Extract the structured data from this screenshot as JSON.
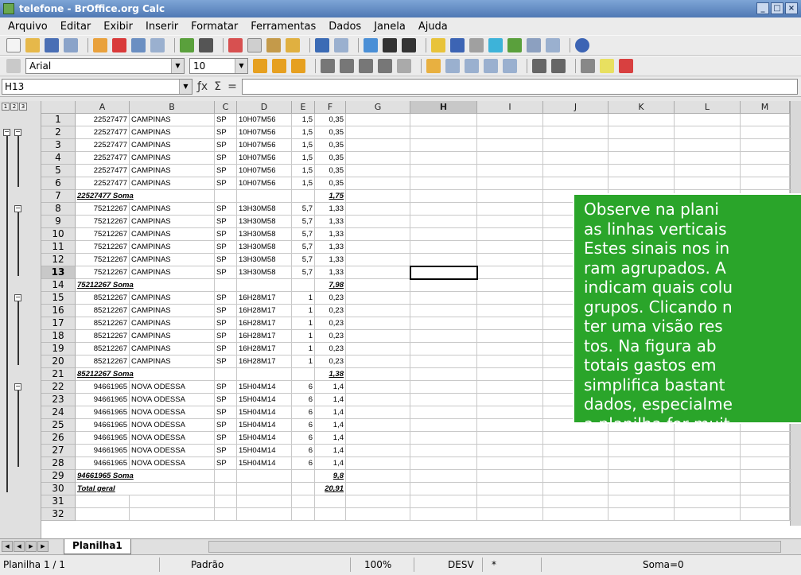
{
  "window": {
    "title": "telefone - BrOffice.org Calc",
    "buttons": [
      "_",
      "□",
      "×"
    ]
  },
  "menu": [
    "Arquivo",
    "Editar",
    "Exibir",
    "Inserir",
    "Formatar",
    "Ferramentas",
    "Dados",
    "Janela",
    "Ajuda"
  ],
  "formatting": {
    "font_name": "Arial",
    "font_size": "10"
  },
  "formula_bar": {
    "cell_ref": "H13",
    "content": ""
  },
  "outline_levels": [
    "1",
    "2",
    "3"
  ],
  "columns": [
    "A",
    "B",
    "C",
    "D",
    "E",
    "F",
    "G",
    "H",
    "I",
    "J",
    "K",
    "L",
    "M"
  ],
  "active_column": "H",
  "active_row": "13",
  "rows": [
    {
      "n": "1",
      "a": "22527477",
      "b": "CAMPINAS",
      "c": "SP",
      "d": "10H07M56",
      "e": "1,5",
      "f": "0,35"
    },
    {
      "n": "2",
      "a": "22527477",
      "b": "CAMPINAS",
      "c": "SP",
      "d": "10H07M56",
      "e": "1,5",
      "f": "0,35"
    },
    {
      "n": "3",
      "a": "22527477",
      "b": "CAMPINAS",
      "c": "SP",
      "d": "10H07M56",
      "e": "1,5",
      "f": "0,35"
    },
    {
      "n": "4",
      "a": "22527477",
      "b": "CAMPINAS",
      "c": "SP",
      "d": "10H07M56",
      "e": "1,5",
      "f": "0,35"
    },
    {
      "n": "5",
      "a": "22527477",
      "b": "CAMPINAS",
      "c": "SP",
      "d": "10H07M56",
      "e": "1,5",
      "f": "0,35"
    },
    {
      "n": "6",
      "a": "22527477",
      "b": "CAMPINAS",
      "c": "SP",
      "d": "10H07M56",
      "e": "1,5",
      "f": "0,35"
    },
    {
      "n": "7",
      "a": "22527477 Soma",
      "b": "",
      "c": "",
      "d": "",
      "e": "",
      "f": "1,75",
      "sum": true
    },
    {
      "n": "8",
      "a": "75212267",
      "b": "CAMPINAS",
      "c": "SP",
      "d": "13H30M58",
      "e": "5,7",
      "f": "1,33"
    },
    {
      "n": "9",
      "a": "75212267",
      "b": "CAMPINAS",
      "c": "SP",
      "d": "13H30M58",
      "e": "5,7",
      "f": "1,33"
    },
    {
      "n": "10",
      "a": "75212267",
      "b": "CAMPINAS",
      "c": "SP",
      "d": "13H30M58",
      "e": "5,7",
      "f": "1,33"
    },
    {
      "n": "11",
      "a": "75212267",
      "b": "CAMPINAS",
      "c": "SP",
      "d": "13H30M58",
      "e": "5,7",
      "f": "1,33"
    },
    {
      "n": "12",
      "a": "75212267",
      "b": "CAMPINAS",
      "c": "SP",
      "d": "13H30M58",
      "e": "5,7",
      "f": "1,33"
    },
    {
      "n": "13",
      "a": "75212267",
      "b": "CAMPINAS",
      "c": "SP",
      "d": "13H30M58",
      "e": "5,7",
      "f": "1,33"
    },
    {
      "n": "14",
      "a": "75212267 Soma",
      "b": "",
      "c": "",
      "d": "",
      "e": "",
      "f": "7,98",
      "sum": true
    },
    {
      "n": "15",
      "a": "85212267",
      "b": "CAMPINAS",
      "c": "SP",
      "d": "16H28M17",
      "e": "1",
      "f": "0,23"
    },
    {
      "n": "16",
      "a": "85212267",
      "b": "CAMPINAS",
      "c": "SP",
      "d": "16H28M17",
      "e": "1",
      "f": "0,23"
    },
    {
      "n": "17",
      "a": "85212267",
      "b": "CAMPINAS",
      "c": "SP",
      "d": "16H28M17",
      "e": "1",
      "f": "0,23"
    },
    {
      "n": "18",
      "a": "85212267",
      "b": "CAMPINAS",
      "c": "SP",
      "d": "16H28M17",
      "e": "1",
      "f": "0,23"
    },
    {
      "n": "19",
      "a": "85212267",
      "b": "CAMPINAS",
      "c": "SP",
      "d": "16H28M17",
      "e": "1",
      "f": "0,23"
    },
    {
      "n": "20",
      "a": "85212267",
      "b": "CAMPINAS",
      "c": "SP",
      "d": "16H28M17",
      "e": "1",
      "f": "0,23"
    },
    {
      "n": "21",
      "a": "85212267 Soma",
      "b": "",
      "c": "",
      "d": "",
      "e": "",
      "f": "1,38",
      "sum": true
    },
    {
      "n": "22",
      "a": "94661965",
      "b": "NOVA ODESSA",
      "c": "SP",
      "d": "15H04M14",
      "e": "6",
      "f": "1,4"
    },
    {
      "n": "23",
      "a": "94661965",
      "b": "NOVA ODESSA",
      "c": "SP",
      "d": "15H04M14",
      "e": "6",
      "f": "1,4"
    },
    {
      "n": "24",
      "a": "94661965",
      "b": "NOVA ODESSA",
      "c": "SP",
      "d": "15H04M14",
      "e": "6",
      "f": "1,4"
    },
    {
      "n": "25",
      "a": "94661965",
      "b": "NOVA ODESSA",
      "c": "SP",
      "d": "15H04M14",
      "e": "6",
      "f": "1,4"
    },
    {
      "n": "26",
      "a": "94661965",
      "b": "NOVA ODESSA",
      "c": "SP",
      "d": "15H04M14",
      "e": "6",
      "f": "1,4"
    },
    {
      "n": "27",
      "a": "94661965",
      "b": "NOVA ODESSA",
      "c": "SP",
      "d": "15H04M14",
      "e": "6",
      "f": "1,4"
    },
    {
      "n": "28",
      "a": "94661965",
      "b": "NOVA ODESSA",
      "c": "SP",
      "d": "15H04M14",
      "e": "6",
      "f": "1,4"
    },
    {
      "n": "29",
      "a": "94661965 Soma",
      "b": "",
      "c": "",
      "d": "",
      "e": "",
      "f": "9,8",
      "sum": true
    },
    {
      "n": "30",
      "a": "Total geral",
      "b": "",
      "c": "",
      "d": "",
      "e": "",
      "f": "20,91",
      "sum": true
    },
    {
      "n": "31",
      "a": "",
      "b": "",
      "c": "",
      "d": "",
      "e": "",
      "f": ""
    },
    {
      "n": "32",
      "a": "",
      "b": "",
      "c": "",
      "d": "",
      "e": "",
      "f": ""
    }
  ],
  "callout_lines": [
    "Observe na plani",
    "as linhas verticais",
    "Estes sinais nos in",
    "ram agrupados. A",
    "indicam quais colu",
    "grupos. Clicando n",
    "ter uma visão res",
    "tos. Na figura ab",
    "totais gastos em",
    "simplifica bastant",
    "dados, especialme",
    "a planilha for muit"
  ],
  "sheet_tab": "Planilha1",
  "status": {
    "sheet": "Planilha 1 / 1",
    "style": "Padrão",
    "zoom": "100%",
    "mode": "DESV",
    "modified": "*",
    "sum": "Soma=0"
  },
  "colors": {
    "callout_bg": "#2aa52a",
    "titlebar": "#4f78b4"
  }
}
